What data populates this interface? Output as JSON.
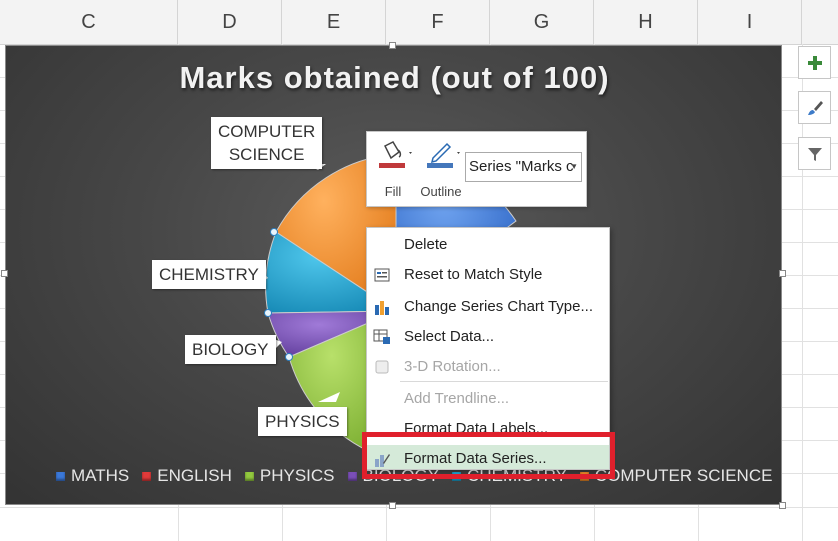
{
  "columns": [
    "C",
    "D",
    "E",
    "F",
    "G",
    "H",
    "I"
  ],
  "chart": {
    "title": "Marks obtained (out of 100)",
    "callouts": {
      "computer_science": "COMPUTER SCIENCE",
      "chemistry": "CHEMISTRY",
      "biology": "BIOLOGY",
      "physics": "PHYSICS"
    },
    "legend": [
      {
        "label": "MATHS",
        "color": "#3b78d8"
      },
      {
        "label": "ENGLISH",
        "color": "#e03a3a"
      },
      {
        "label": "PHYSICS",
        "color": "#92c83e"
      },
      {
        "label": "BIOLOGY",
        "color": "#7b4fb8"
      },
      {
        "label": "CHEMISTRY",
        "color": "#1ea6d4"
      },
      {
        "label": "COMPUTER SCIENCE",
        "color": "#f28c28"
      }
    ]
  },
  "side_buttons": {
    "add": "chart-elements-plus-icon",
    "styles": "chart-styles-brush-icon",
    "filters": "chart-filters-funnel-icon"
  },
  "mini_toolbar": {
    "fill_label": "Fill",
    "outline_label": "Outline",
    "series_selector_value": "Series \"Marks c"
  },
  "context_menu": {
    "items": [
      {
        "label": "Delete",
        "enabled": true
      },
      {
        "label": "Reset to Match Style",
        "enabled": true
      },
      {
        "label": "Change Series Chart Type...",
        "enabled": true
      },
      {
        "label": "Select Data...",
        "enabled": true
      },
      {
        "label": "3-D Rotation...",
        "enabled": false
      },
      {
        "label": "Add Trendline...",
        "enabled": false
      },
      {
        "label": "Format Data Labels...",
        "enabled": true
      },
      {
        "label": "Format Data Series...",
        "enabled": true,
        "highlighted": true
      }
    ]
  },
  "colors": {
    "accent_red_box": "#e0202c",
    "highlight": "#d5ead9",
    "chart_bg": "#474747"
  }
}
